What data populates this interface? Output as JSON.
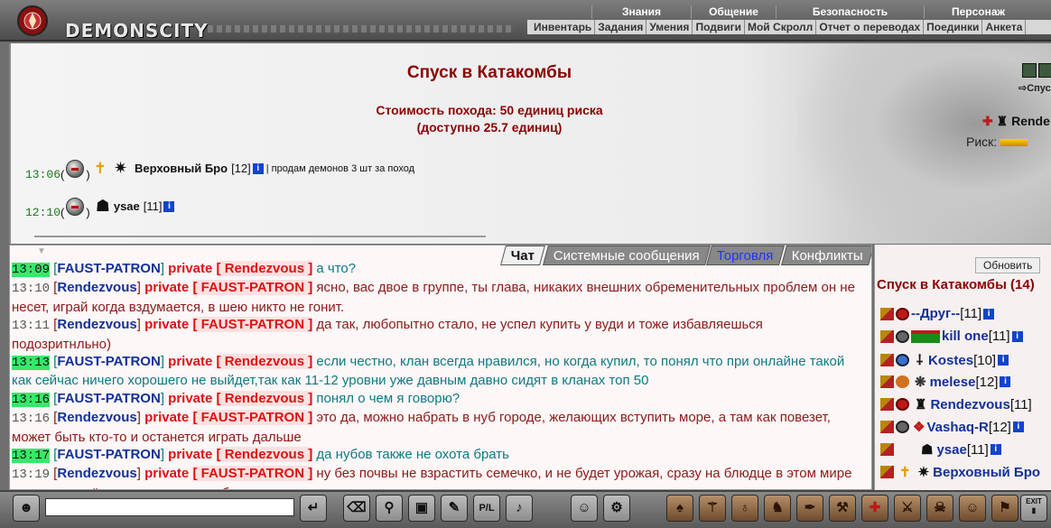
{
  "app": {
    "logo_text": "DEMONSCITY"
  },
  "main_nav": [
    "Знания",
    "Общение",
    "Безопасность",
    "Персонаж"
  ],
  "sub_nav": [
    "Инвентарь",
    "Задания",
    "Умения",
    "Подвиги",
    "Мой Скролл",
    "Отчет о переводах",
    "Поединки",
    "Анкета"
  ],
  "room": {
    "title": "Спуск в Катакомбы",
    "cost_line1": "Стоимость похода: 50 единиц риска",
    "cost_line2": "(доступно 25.7 единиц)",
    "entries": [
      {
        "time": "13:06",
        "nick": "Верховный Бро",
        "level": "[12]",
        "message": "| продам демонов 3 шт за поход"
      },
      {
        "time": "12:10",
        "nick": "ysae",
        "level": "[11]",
        "message": ""
      }
    ],
    "side": {
      "go_label": "Спуск",
      "opponent": "Rende",
      "risk_label": "Риск:"
    }
  },
  "chat": {
    "tabs": [
      "Чат",
      "Системные сообщения",
      "Торговля",
      "Конфликты"
    ],
    "messages": [
      {
        "time": "13:09",
        "hl": true,
        "from": "FAUST-PATRON",
        "to": "Rendezvous",
        "text": "а что?",
        "teal": true
      },
      {
        "time": "13:10",
        "hl": false,
        "from": "Rendezvous",
        "to": "FAUST-PATRON",
        "text": "ясно, вас двое в группе, ты глава, никаких внешних обременительных проблем он не несет, играй когда вздумается, в шею никто не гонит.",
        "teal": false
      },
      {
        "time": "13:11",
        "hl": false,
        "from": "Rendezvous",
        "to": "FAUST-PATRON",
        "text": "да так, любопытно стало, не успел купить у вуди и тоже избавляешься подозритнльно)",
        "teal": false
      },
      {
        "time": "13:13",
        "hl": true,
        "from": "FAUST-PATRON",
        "to": "Rendezvous",
        "text": "если честно, клан всегда нравился, но когда купил, то понял что при онлайне такой как сейчас ничего хорошего не выйдет,так как 11-12 уровни уже давным давно сидят в кланах топ 50",
        "teal": true
      },
      {
        "time": "13:16",
        "hl": true,
        "from": "FAUST-PATRON",
        "to": "Rendezvous",
        "text": "понял о чем я говорю?",
        "teal": true
      },
      {
        "time": "13:16",
        "hl": false,
        "from": "Rendezvous",
        "to": "FAUST-PATRON",
        "text": "это да, можно набрать в нуб городе, желающих вступить море, а там как повезет, может быть кто-то и останется играть дальше",
        "teal": false
      },
      {
        "time": "13:17",
        "hl": true,
        "from": "FAUST-PATRON",
        "to": "Rendezvous",
        "text": "да нубов также не охота брать",
        "teal": true
      },
      {
        "time": "13:19",
        "hl": false,
        "from": "Rendezvous",
        "to": "FAUST-PATRON",
        "text": "ну без почвы не взрастить семечко, и не будет урожая, сразу на блюдце в этом мире ничего не даётся, всего нужно добиваться самому.",
        "teal": false
      }
    ],
    "private_label": "private"
  },
  "players": {
    "refresh_label": "Обновить",
    "title": "Спуск в Катакомбы (14)",
    "list": [
      {
        "name": "--Друг--",
        "level": "[11]"
      },
      {
        "name": "kill one",
        "level": "[11]"
      },
      {
        "name": "Kostes",
        "level": "[10]"
      },
      {
        "name": "melese",
        "level": "[12]"
      },
      {
        "name": "Rendezvous",
        "level": "[11]"
      },
      {
        "name": "Vashaq-R",
        "level": "[12]"
      },
      {
        "name": "ysae",
        "level": "[11]"
      },
      {
        "name": "Верховный Бро",
        "level": ""
      }
    ]
  },
  "toolbar": {
    "exit_label": "EXIT",
    "pl_label": "P/L"
  }
}
